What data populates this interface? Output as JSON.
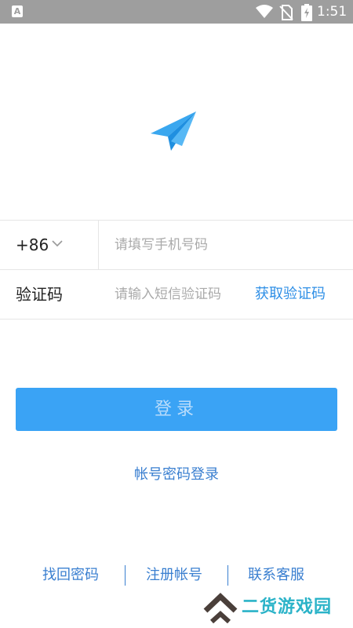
{
  "status_bar": {
    "time": "1:51",
    "left_icon": "A",
    "icons": [
      "wifi-icon",
      "no-sim-icon",
      "battery-charging-icon"
    ]
  },
  "logo": {
    "icon": "paper-plane-icon"
  },
  "phone_row": {
    "country_code": "+86",
    "placeholder": "请填写手机号码"
  },
  "code_row": {
    "label": "验证码",
    "placeholder": "请输入短信验证码",
    "get_code": "获取验证码"
  },
  "login_button": "登录",
  "account_login": "帐号密码登录",
  "bottom_links": [
    "找回密码",
    "注册帐号",
    "联系客服"
  ],
  "watermark": "二货游戏园",
  "colors": {
    "accent": "#3aa3f5",
    "link": "#3a7fd0",
    "status_bar": "#9e9e9e"
  }
}
